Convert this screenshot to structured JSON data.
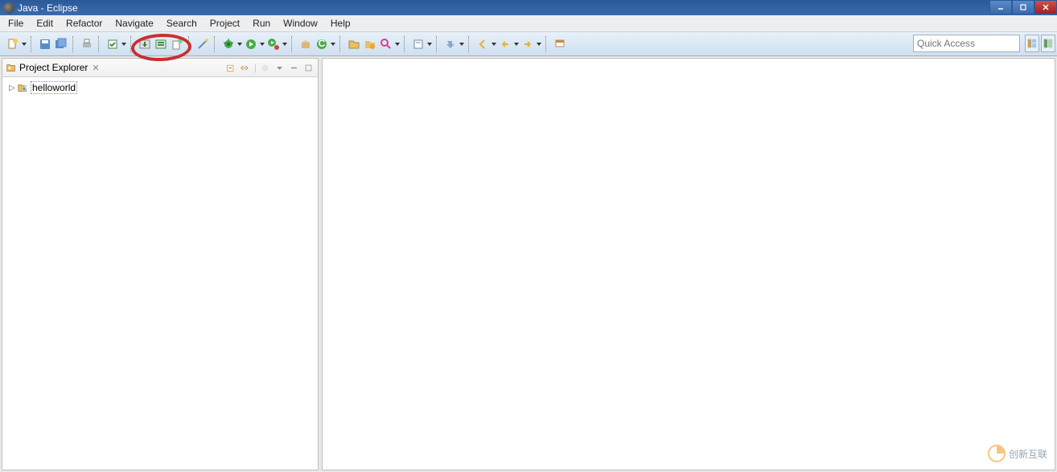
{
  "title": "Java - Eclipse",
  "menu": [
    "File",
    "Edit",
    "Refactor",
    "Navigate",
    "Search",
    "Project",
    "Run",
    "Window",
    "Help"
  ],
  "quick_access_placeholder": "Quick Access",
  "project_explorer": {
    "title": "Project Explorer",
    "items": [
      {
        "label": "helloworld",
        "icon": "java-project"
      }
    ]
  },
  "watermark": "创新互联"
}
